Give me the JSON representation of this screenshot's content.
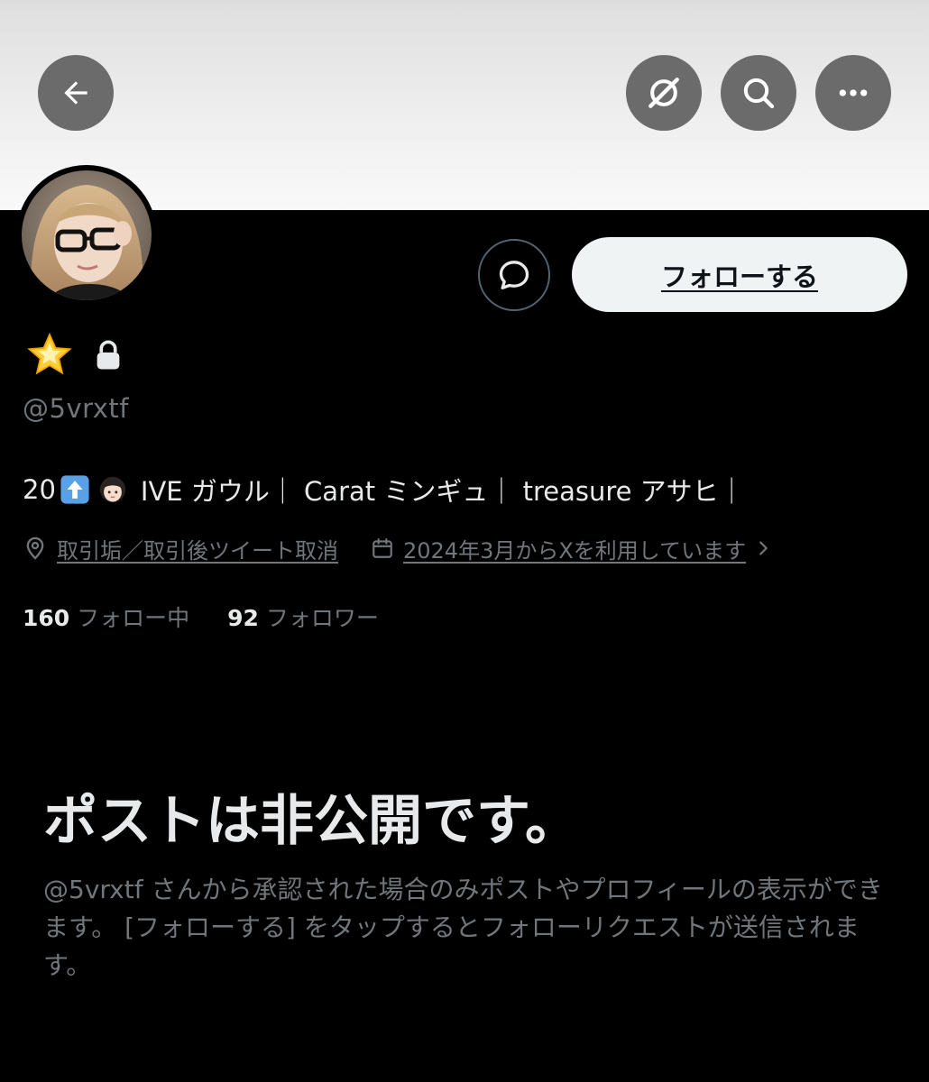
{
  "header": {
    "back_icon": "arrow-left-icon",
    "translate_icon": "grok-icon",
    "search_icon": "search-icon",
    "more_icon": "more-horizontal-icon",
    "banner_color": "#e8e8e8",
    "button_color": "#6b6b6b"
  },
  "profile": {
    "message_icon": "message-bubble-icon",
    "follow_label": "フォローする",
    "name_emoji": "glowing-star-icon",
    "lock_icon": "lock-icon",
    "handle": "@5vrxtf",
    "bio": {
      "prefix": "20",
      "arrow_emoji": "up-arrow-icon",
      "girl_emoji": "girl-emoji-icon",
      "text": "IVE ガウル｜ Carat ミンギュ｜ treasure アサヒ｜"
    },
    "location": "取引垢／取引後ツイート取消",
    "joined": "2024年3月からXを利用しています",
    "following_count": "160",
    "following_label": "フォロー中",
    "followers_count": "92",
    "followers_label": "フォロワー"
  },
  "private_notice": {
    "title": "ポストは非公開です。",
    "body": "@5vrxtf さんから承認された場合のみポストやプロフィールの表示ができます。 [フォローする] をタップするとフォローリクエストが送信されます。"
  },
  "colors": {
    "background": "#000000",
    "primary_text": "#e7e9ea",
    "secondary_text": "#71767b",
    "follow_button_bg": "#eff3f4"
  }
}
